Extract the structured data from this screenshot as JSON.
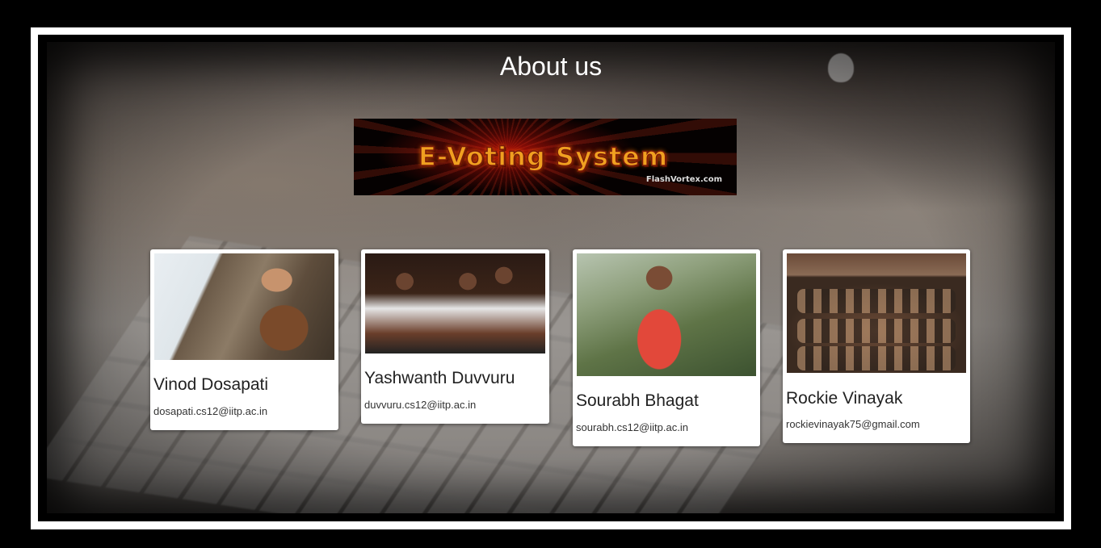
{
  "page": {
    "title": "About us"
  },
  "banner": {
    "text": "E-Voting System",
    "sub": "FlashVortex.com"
  },
  "members": [
    {
      "name": "Vinod Dosapati",
      "email": "dosapati.cs12@iitp.ac.in"
    },
    {
      "name": "Yashwanth Duvvuru",
      "email": "duvvuru.cs12@iitp.ac.in"
    },
    {
      "name": "Sourabh Bhagat",
      "email": "sourabh.cs12@iitp.ac.in"
    },
    {
      "name": "Rockie Vinayak",
      "email": "rockievinayak75@gmail.com"
    }
  ],
  "colors": {
    "frame": "#ffffff",
    "card": "#ffffff",
    "title_text": "#ffffff",
    "banner_text": "#f0a020"
  }
}
